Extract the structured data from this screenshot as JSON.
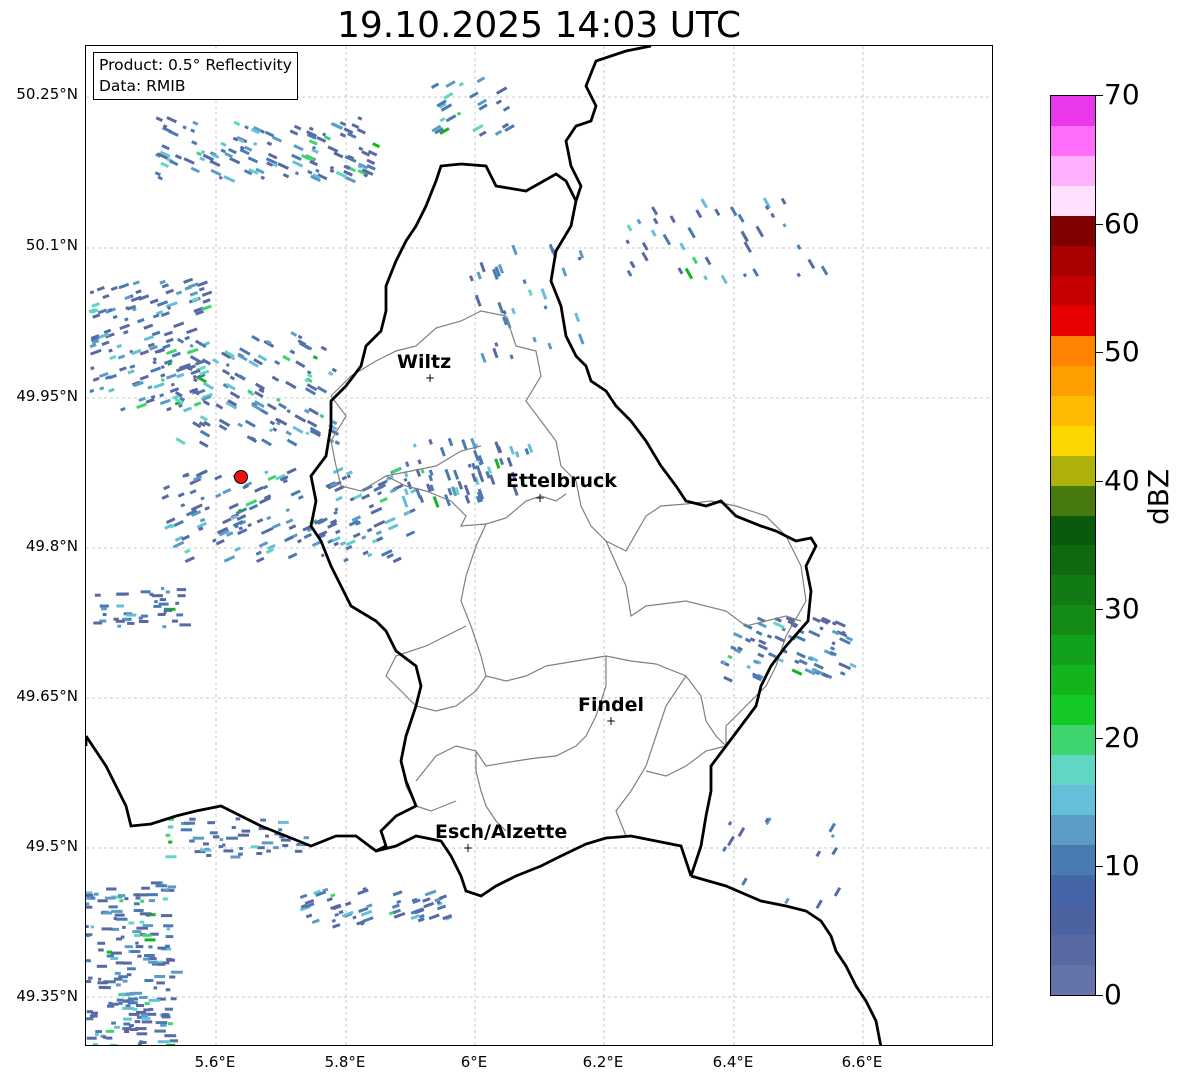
{
  "title": "19.10.2025 14:03 UTC",
  "info": {
    "product": "Product: 0.5° Reflectivity",
    "data": "Data: RMIB"
  },
  "lat_labels": [
    "50.25°N",
    "50.1°N",
    "49.95°N",
    "49.8°N",
    "49.65°N",
    "49.5°N",
    "49.35°N"
  ],
  "lon_labels": [
    "5.6°E",
    "5.8°E",
    "6°E",
    "6.2°E",
    "6.4°E",
    "6.6°E"
  ],
  "cities": [
    {
      "name": "Wiltz",
      "marker": "+"
    },
    {
      "name": "Ettelbruck",
      "marker": "+"
    },
    {
      "name": "Findel",
      "marker": "+"
    },
    {
      "name": "Esch/Alzette",
      "marker": "+"
    }
  ],
  "colorbar": {
    "label": "dBZ",
    "ticks": [
      "0",
      "10",
      "20",
      "30",
      "40",
      "50",
      "60",
      "70"
    ],
    "colors": [
      "#6574a8",
      "#5869a3",
      "#4c63a2",
      "#4466a8",
      "#4a7ab2",
      "#5a9cc6",
      "#66bfd8",
      "#61d6c3",
      "#3ed46e",
      "#14c825",
      "#12b51c",
      "#12a11a",
      "#138c15",
      "#127a12",
      "#0e6910",
      "#0a5a0c",
      "#467a0e",
      "#aeb10c",
      "#fcd600",
      "#fdba00",
      "#fe9f00",
      "#ff8200",
      "#e80000",
      "#c60000",
      "#a80000",
      "#800000",
      "#ffe0ff",
      "#ffb0ff",
      "#ff6df9",
      "#ea37ec"
    ]
  },
  "colors": {
    "border": "#000000",
    "canton_lines": "#808080",
    "grid": "#bbbbbb",
    "radar_site": "#ee1111"
  }
}
